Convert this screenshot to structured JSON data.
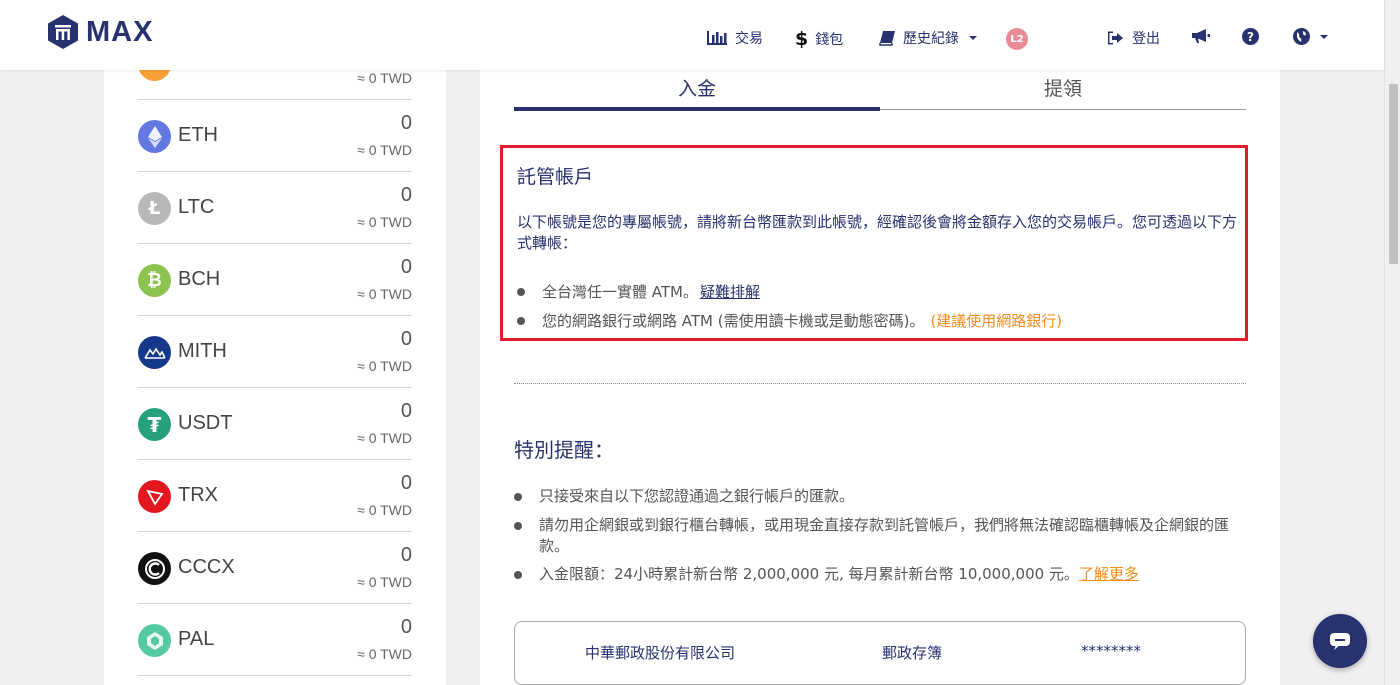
{
  "brand": {
    "name": "MAX"
  },
  "nav": {
    "trade": "交易",
    "wallet": "錢包",
    "history": "歷史紀錄",
    "level_badge": "L2",
    "logout": "登出"
  },
  "coins": [
    {
      "name": "",
      "amount": "",
      "twd": "≈ 0 TWD",
      "icon": "partial-coin-icon",
      "color": "#f7a035"
    },
    {
      "name": "ETH",
      "amount": "0",
      "twd": "≈ 0 TWD",
      "icon": "eth-icon",
      "color": "#6279e3"
    },
    {
      "name": "LTC",
      "amount": "0",
      "twd": "≈ 0 TWD",
      "icon": "ltc-icon",
      "color": "#b8b8b8"
    },
    {
      "name": "BCH",
      "amount": "0",
      "twd": "≈ 0 TWD",
      "icon": "bch-icon",
      "color": "#8dc351"
    },
    {
      "name": "MITH",
      "amount": "0",
      "twd": "≈ 0 TWD",
      "icon": "mith-icon",
      "color": "#14398a"
    },
    {
      "name": "USDT",
      "amount": "0",
      "twd": "≈ 0 TWD",
      "icon": "usdt-icon",
      "color": "#26a17b"
    },
    {
      "name": "TRX",
      "amount": "0",
      "twd": "≈ 0 TWD",
      "icon": "trx-icon",
      "color": "#e5171e"
    },
    {
      "name": "CCCX",
      "amount": "0",
      "twd": "≈ 0 TWD",
      "icon": "cccx-icon",
      "color": "#111111"
    },
    {
      "name": "PAL",
      "amount": "0",
      "twd": "≈ 0 TWD",
      "icon": "pal-icon",
      "color": "#55c8a4"
    }
  ],
  "tabs": {
    "deposit": "入金",
    "withdraw": "提領"
  },
  "trust": {
    "title": "託管帳戶",
    "description": "以下帳號是您的專屬帳號，請將新台幣匯款到此帳號，經確認後會將金額存入您的交易帳戶。您可透過以下方式轉帳：",
    "method1": "全台灣任一實體 ATM。",
    "method1_link": "疑難排解",
    "method2": "您的網路銀行或網路 ATM (需使用讀卡機或是動態密碼)。",
    "method2_note": "(建議使用網路銀行)"
  },
  "reminder": {
    "title": "特別提醒：",
    "item1": "只接受來自以下您認證通過之銀行帳戶的匯款。",
    "item2": "請勿用企網銀或到銀行櫃台轉帳，或用現金直接存款到託管帳戶，我們將無法確認臨櫃轉帳及企網銀的匯款。",
    "item3": "入金限額：24小時累計新台幣 2,000,000 元, 每月累計新台幣 10,000,000 元。",
    "item3_link": "了解更多"
  },
  "bank": {
    "name": "中華郵政股份有限公司",
    "branch": "郵政存簿",
    "account": "********"
  },
  "colors": {
    "brand": "#27326e",
    "alert": "#e21c2a",
    "accent": "#f08c1c"
  }
}
